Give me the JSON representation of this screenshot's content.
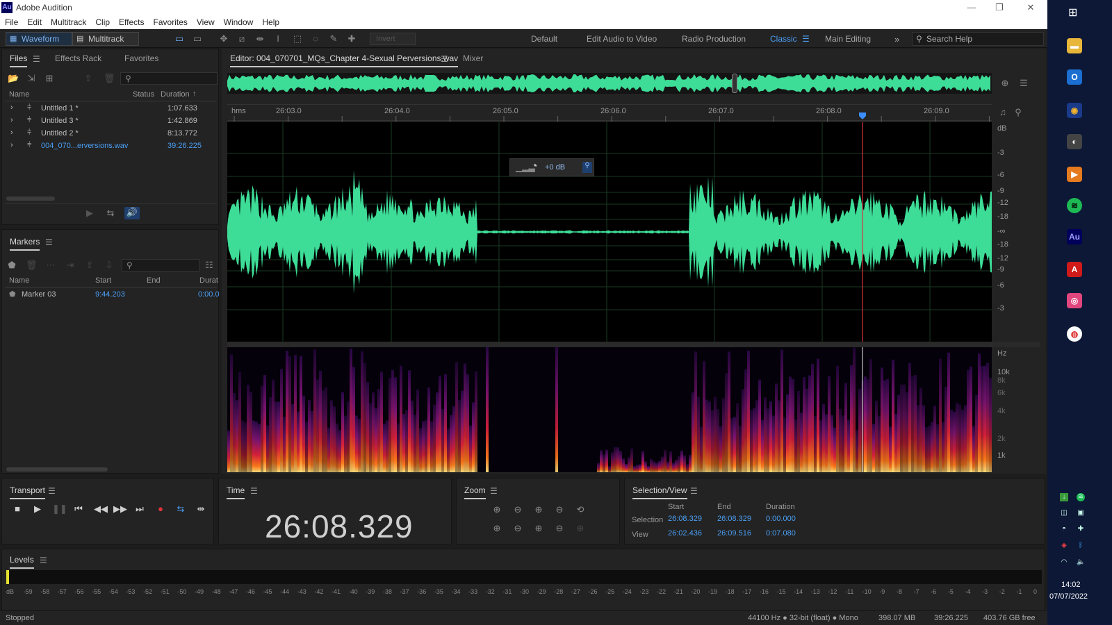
{
  "app": {
    "title": "Adobe Audition",
    "logo": "Au"
  },
  "menu": [
    "File",
    "Edit",
    "Multitrack",
    "Clip",
    "Effects",
    "Favorites",
    "View",
    "Window",
    "Help"
  ],
  "toolbar": {
    "waveform_label": "Waveform",
    "multitrack_label": "Multitrack",
    "invert_label": "Invert",
    "workspaces": [
      "Default",
      "Edit Audio to Video",
      "Radio Production",
      "Classic",
      "Main Editing"
    ],
    "active_workspace": "Classic",
    "search_placeholder": "Search Help"
  },
  "files_panel": {
    "tabs": [
      "Files",
      "Effects Rack",
      "Favorites"
    ],
    "columns": [
      "Name",
      "Status",
      "Duration"
    ],
    "files": [
      {
        "name": "Untitled 1 *",
        "duration": "1:07.633"
      },
      {
        "name": "Untitled 3 *",
        "duration": "1:42.869"
      },
      {
        "name": "Untitled 2 *",
        "duration": "8:13.772"
      },
      {
        "name": "004_070...erversions.wav",
        "duration": "39:26.225"
      }
    ]
  },
  "markers_panel": {
    "title": "Markers",
    "columns": [
      "Name",
      "Start",
      "End",
      "Durat"
    ],
    "markers": [
      {
        "name": "Marker 03",
        "start": "9:44.203",
        "end": "",
        "duration": "0:00.0"
      }
    ]
  },
  "editor": {
    "tab_label": "Editor: 004_070701_MQs_Chapter 4-Sexual Perversions.wav",
    "mixer_label": "Mixer",
    "ruler_unit": "hms",
    "ruler_ticks": [
      "26:03.0",
      "26:04.0",
      "26:05.0",
      "26:06.0",
      "26:07.0",
      "26:08.0",
      "26:09.0"
    ],
    "db_labels": [
      "dB",
      "-3",
      "-6",
      "-9",
      "-12",
      "-18",
      "-∞",
      "-18",
      "-12",
      "-9",
      "-6",
      "-3"
    ],
    "hz_labels": [
      "Hz",
      "10k",
      "8k",
      "6k",
      "4k",
      "2k",
      "1k"
    ],
    "hud_gain": "+0 dB",
    "playhead_time": "26:08.329"
  },
  "transport": {
    "title": "Transport"
  },
  "time_panel": {
    "title": "Time",
    "value": "26:08.329"
  },
  "zoom_panel": {
    "title": "Zoom"
  },
  "selection_panel": {
    "title": "Selection/View",
    "columns": [
      "Start",
      "End",
      "Duration"
    ],
    "selection": {
      "label": "Selection",
      "start": "26:08.329",
      "end": "26:08.329",
      "duration": "0:00.000"
    },
    "view": {
      "label": "View",
      "start": "26:02.436",
      "end": "26:09.516",
      "duration": "0:07.080"
    }
  },
  "levels": {
    "title": "Levels",
    "scale": [
      "dB",
      "-59",
      "-58",
      "-57",
      "-56",
      "-55",
      "-54",
      "-53",
      "-52",
      "-51",
      "-50",
      "-49",
      "-48",
      "-47",
      "-46",
      "-45",
      "-44",
      "-43",
      "-42",
      "-41",
      "-40",
      "-39",
      "-38",
      "-37",
      "-36",
      "-35",
      "-34",
      "-33",
      "-32",
      "-31",
      "-30",
      "-29",
      "-28",
      "-27",
      "-26",
      "-25",
      "-24",
      "-23",
      "-22",
      "-21",
      "-20",
      "-19",
      "-18",
      "-17",
      "-16",
      "-15",
      "-14",
      "-13",
      "-12",
      "-11",
      "-10",
      "-9",
      "-8",
      "-7",
      "-6",
      "-5",
      "-4",
      "-3",
      "-2",
      "-1",
      "0"
    ]
  },
  "status": {
    "state": "Stopped",
    "format": "44100 Hz ● 32-bit (float) ● Mono",
    "size": "398.07 MB",
    "duration": "39:26.225",
    "free": "403.76 GB free"
  },
  "taskbar": {
    "time": "14:02",
    "date": "07/07/2022"
  },
  "colors": {
    "waveform": "#3ddc97",
    "accent": "#4a9ff5",
    "playhead": "#d9343d"
  }
}
